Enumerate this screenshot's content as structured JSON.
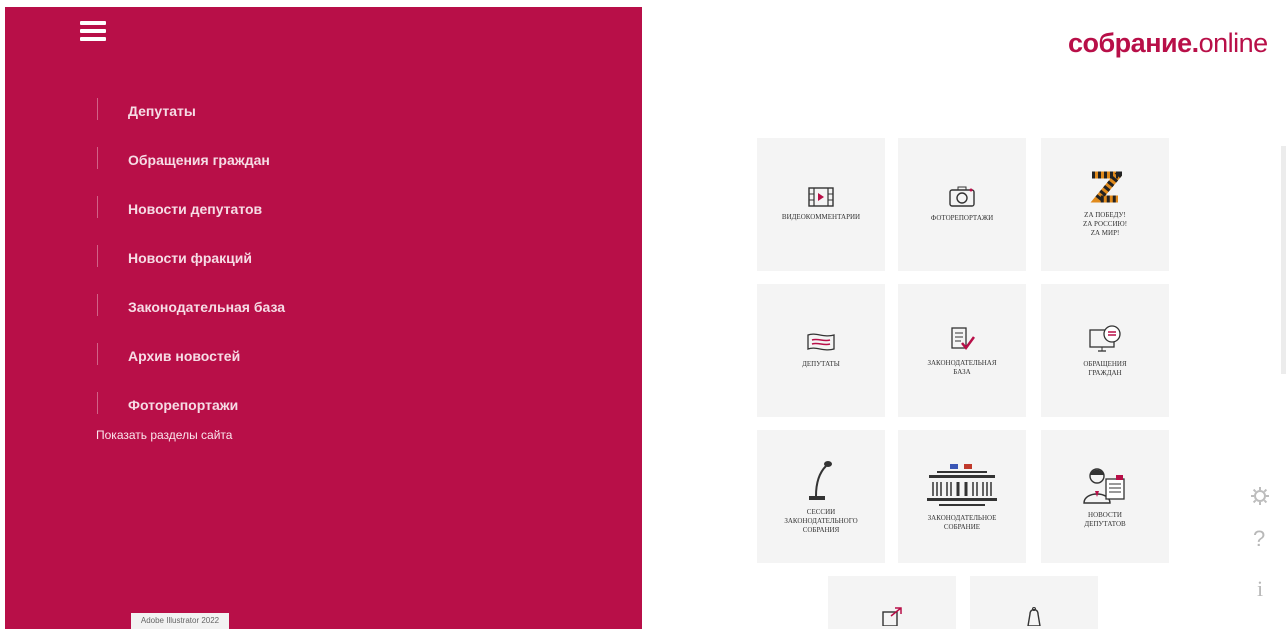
{
  "sidebar": {
    "items": [
      {
        "label": "Депутаты"
      },
      {
        "label": "Обращения граждан"
      },
      {
        "label": "Новости депутатов"
      },
      {
        "label": "Новости фракций"
      },
      {
        "label": "Законодательная база"
      },
      {
        "label": "Архив новостей"
      },
      {
        "label": "Фоторепортажи"
      }
    ],
    "show_sections": "Показать разделы сайта",
    "watermark": "Adobe Illustrator 2022"
  },
  "logo": {
    "part1": "собрание.",
    "part2": "online"
  },
  "tiles": [
    {
      "label": "ВИДЕОКОММЕНТАРИИ",
      "icon": "video-icon"
    },
    {
      "label": "ФОТОРЕПОРТАЖИ",
      "icon": "camera-icon"
    },
    {
      "label": "ZА ПОБЕДУ!\nZА РОССИЮ!\nZА МИР!",
      "icon": "z-ribbon-icon"
    },
    {
      "label": "ДЕПУТАТЫ",
      "icon": "flag-icon"
    },
    {
      "label": "ЗАКОНОДАТЕЛЬНАЯ\nБАЗА",
      "icon": "document-check-icon"
    },
    {
      "label": "ОБРАЩЕНИЯ\nГРАЖДАН",
      "icon": "monitor-message-icon"
    },
    {
      "label": "СЕССИИ\nЗАКОНОДАТЕЛЬНОГО\nСОБРАНИЯ",
      "icon": "microphone-icon"
    },
    {
      "label": "ЗАКОНОДАТЕЛЬНОЕ\nСОБРАНИЕ",
      "icon": "building-icon"
    },
    {
      "label": "НОВОСТИ\nДЕПУТАТОВ",
      "icon": "person-news-icon"
    },
    {
      "label": "",
      "icon": "share-icon"
    },
    {
      "label": "",
      "icon": "bag-icon"
    }
  ],
  "utility": {
    "question": "?",
    "info": "i"
  },
  "colors": {
    "brand": "#b80f48",
    "tile_bg": "#f4f4f4"
  }
}
